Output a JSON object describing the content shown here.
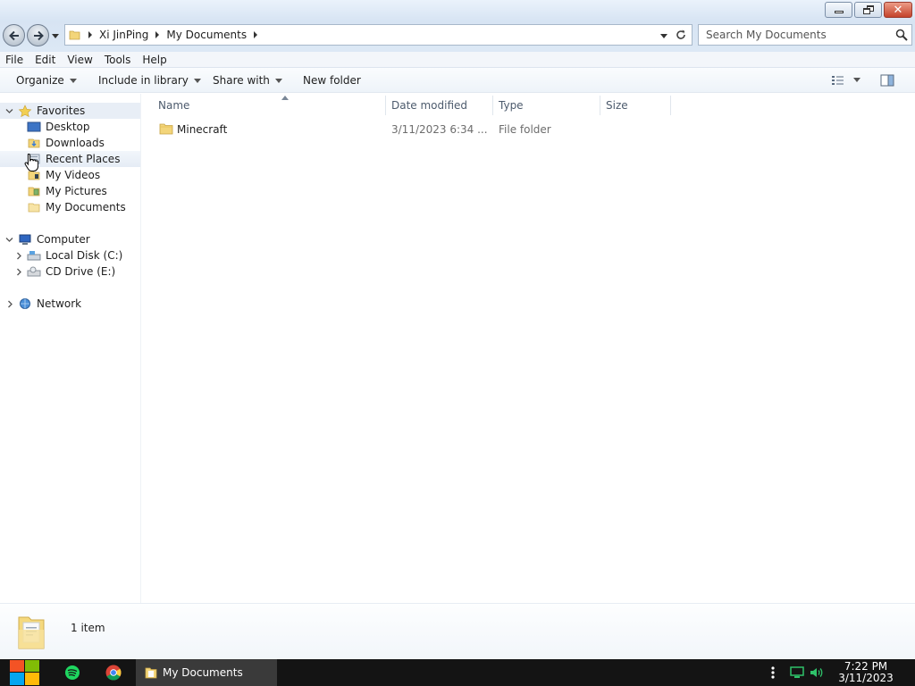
{
  "window": {
    "title": "My Documents"
  },
  "address": {
    "crumbs": [
      "Xi JinPing",
      "My Documents"
    ]
  },
  "search": {
    "placeholder": "Search My Documents"
  },
  "menu": {
    "items": [
      "File",
      "Edit",
      "View",
      "Tools",
      "Help"
    ]
  },
  "commands": {
    "organize": "Organize",
    "include_in_library": "Include in library",
    "share_with": "Share with",
    "new_folder": "New folder"
  },
  "nav": {
    "favorites": {
      "label": "Favorites",
      "items": [
        "Desktop",
        "Downloads",
        "Recent Places",
        "My Videos",
        "My Pictures",
        "My Documents"
      ]
    },
    "computer": {
      "label": "Computer",
      "items": [
        "Local Disk (C:)",
        "CD Drive (E:)"
      ]
    },
    "network": {
      "label": "Network"
    }
  },
  "columns": {
    "name": "Name",
    "date_modified": "Date modified",
    "type": "Type",
    "size": "Size"
  },
  "files": [
    {
      "name": "Minecraft",
      "date_modified": "3/11/2023 6:34 ...",
      "type": "File folder",
      "size": ""
    }
  ],
  "details": {
    "item_count": "1 item"
  },
  "taskbar": {
    "active_task": "My Documents",
    "time": "7:22 PM",
    "date": "3/11/2023"
  },
  "colors": {
    "accent": "#d7e4f3",
    "folder": "#f3d57a",
    "close_button": "#c4432b",
    "taskbar": "#141414"
  }
}
